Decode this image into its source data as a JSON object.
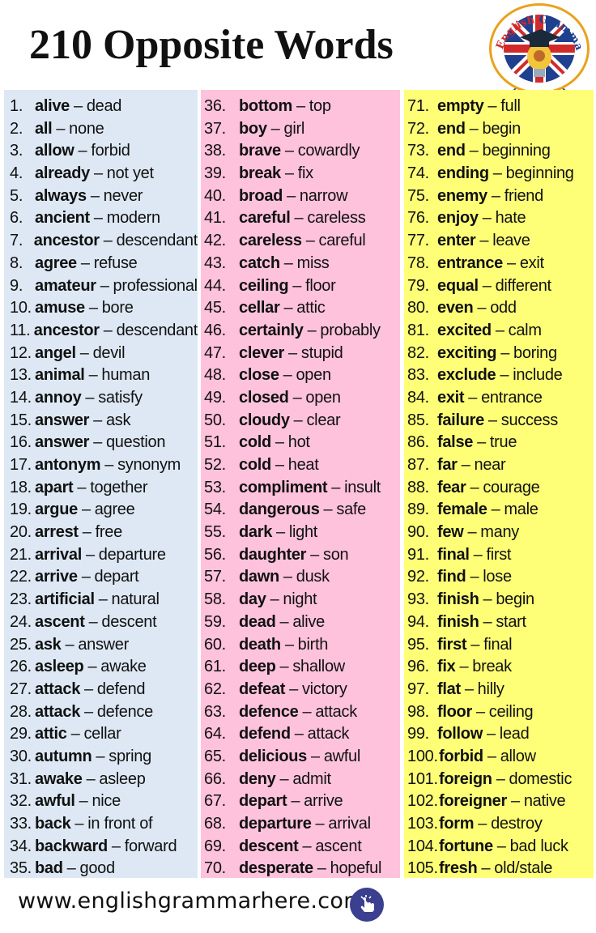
{
  "header": {
    "title": "210 Opposite Words",
    "logo": {
      "icon": "english-grammar-here-logo",
      "text_english": "English",
      "text_grammar": "Grammar",
      "text_here": "Here",
      "text_com": ".Com"
    }
  },
  "columns": [
    {
      "color": "#dde8f4",
      "items": [
        {
          "n": "1.",
          "word": "alive",
          "opposite": "dead"
        },
        {
          "n": "2.",
          "word": "all",
          "opposite": "none"
        },
        {
          "n": "3.",
          "word": "allow",
          "opposite": "forbid"
        },
        {
          "n": "4.",
          "word": "already",
          "opposite": "not yet"
        },
        {
          "n": "5.",
          "word": "always",
          "opposite": "never"
        },
        {
          "n": "6.",
          "word": "ancient",
          "opposite": "modern"
        },
        {
          "n": "7.",
          "word": "ancestor",
          "opposite": "descendant"
        },
        {
          "n": "8.",
          "word": "agree",
          "opposite": "refuse"
        },
        {
          "n": "9.",
          "word": "amateur",
          "opposite": "professional"
        },
        {
          "n": "10.",
          "word": "amuse",
          "opposite": "bore"
        },
        {
          "n": "11.",
          "word": "ancestor",
          "opposite": "descendant"
        },
        {
          "n": "12.",
          "word": "angel",
          "opposite": "devil"
        },
        {
          "n": "13.",
          "word": "animal",
          "opposite": "human"
        },
        {
          "n": "14.",
          "word": "annoy",
          "opposite": "satisfy"
        },
        {
          "n": "15.",
          "word": "answer",
          "opposite": "ask"
        },
        {
          "n": "16.",
          "word": "answer",
          "opposite": "question"
        },
        {
          "n": "17.",
          "word": "antonym",
          "opposite": "synonym"
        },
        {
          "n": "18.",
          "word": "apart",
          "opposite": "together"
        },
        {
          "n": "19.",
          "word": "argue",
          "opposite": "agree"
        },
        {
          "n": "20.",
          "word": "arrest",
          "opposite": "free"
        },
        {
          "n": "21.",
          "word": "arrival",
          "opposite": "departure"
        },
        {
          "n": "22.",
          "word": "arrive",
          "opposite": "depart"
        },
        {
          "n": "23.",
          "word": "artificial",
          "opposite": "natural"
        },
        {
          "n": "24.",
          "word": "ascent",
          "opposite": "descent"
        },
        {
          "n": "25.",
          "word": "ask",
          "opposite": "answer"
        },
        {
          "n": "26.",
          "word": "asleep",
          "opposite": "awake"
        },
        {
          "n": "27.",
          "word": "attack",
          "opposite": "defend"
        },
        {
          "n": "28.",
          "word": "attack",
          "opposite": "defence"
        },
        {
          "n": "29.",
          "word": "attic",
          "opposite": "cellar"
        },
        {
          "n": "30.",
          "word": "autumn",
          "opposite": "spring"
        },
        {
          "n": "31.",
          "word": "awake",
          "opposite": "asleep"
        },
        {
          "n": "32.",
          "word": "awful",
          "opposite": "nice"
        },
        {
          "n": "33.",
          "word": "back",
          "opposite": "in front of"
        },
        {
          "n": "34.",
          "word": "backward",
          "opposite": "forward"
        },
        {
          "n": "35.",
          "word": "bad",
          "opposite": "good"
        }
      ]
    },
    {
      "color": "#ffc2dc",
      "items": [
        {
          "n": "36.",
          "word": "bottom",
          "opposite": "top"
        },
        {
          "n": "37.",
          "word": "boy",
          "opposite": "girl"
        },
        {
          "n": "38.",
          "word": "brave",
          "opposite": "cowardly"
        },
        {
          "n": "39.",
          "word": "break",
          "opposite": "fix"
        },
        {
          "n": "40.",
          "word": "broad",
          "opposite": "narrow"
        },
        {
          "n": "41.",
          "word": "careful",
          "opposite": "careless"
        },
        {
          "n": "42.",
          "word": "careless",
          "opposite": "careful"
        },
        {
          "n": "43.",
          "word": "catch",
          "opposite": "miss"
        },
        {
          "n": "44.",
          "word": "ceiling",
          "opposite": "floor"
        },
        {
          "n": "45.",
          "word": "cellar",
          "opposite": "attic"
        },
        {
          "n": "46.",
          "word": "certainly",
          "opposite": "probably"
        },
        {
          "n": "47.",
          "word": "clever",
          "opposite": "stupid"
        },
        {
          "n": "48.",
          "word": "close",
          "opposite": "open"
        },
        {
          "n": "49.",
          "word": "closed",
          "opposite": "open"
        },
        {
          "n": "50.",
          "word": "cloudy",
          "opposite": "clear"
        },
        {
          "n": "51.",
          "word": "cold",
          "opposite": "hot"
        },
        {
          "n": "52.",
          "word": "cold",
          "opposite": "heat"
        },
        {
          "n": "53.",
          "word": "compliment",
          "opposite": "insult"
        },
        {
          "n": "54.",
          "word": "dangerous",
          "opposite": "safe"
        },
        {
          "n": "55.",
          "word": "dark",
          "opposite": "light"
        },
        {
          "n": "56.",
          "word": "daughter",
          "opposite": "son"
        },
        {
          "n": "57.",
          "word": "dawn",
          "opposite": "dusk"
        },
        {
          "n": "58.",
          "word": "day",
          "opposite": "night"
        },
        {
          "n": "59.",
          "word": "dead",
          "opposite": "alive"
        },
        {
          "n": "60.",
          "word": "death",
          "opposite": "birth"
        },
        {
          "n": "61.",
          "word": "deep",
          "opposite": "shallow"
        },
        {
          "n": "62.",
          "word": "defeat",
          "opposite": "victory"
        },
        {
          "n": "63.",
          "word": "defence",
          "opposite": "attack"
        },
        {
          "n": "64.",
          "word": "defend",
          "opposite": "attack"
        },
        {
          "n": "65.",
          "word": "delicious",
          "opposite": "awful"
        },
        {
          "n": "66.",
          "word": "deny",
          "opposite": "admit"
        },
        {
          "n": "67.",
          "word": "depart",
          "opposite": "arrive"
        },
        {
          "n": "68.",
          "word": "departure",
          "opposite": "arrival"
        },
        {
          "n": "69.",
          "word": "descent",
          "opposite": "ascent"
        },
        {
          "n": "70.",
          "word": "desperate",
          "opposite": "hopeful"
        }
      ]
    },
    {
      "color": "#ffff77",
      "items": [
        {
          "n": "71.",
          "word": "empty",
          "opposite": "full"
        },
        {
          "n": "72.",
          "word": "end",
          "opposite": "begin"
        },
        {
          "n": "73.",
          "word": "end",
          "opposite": "beginning"
        },
        {
          "n": "74.",
          "word": "ending",
          "opposite": "beginning"
        },
        {
          "n": "75.",
          "word": "enemy",
          "opposite": "friend"
        },
        {
          "n": "76.",
          "word": "enjoy",
          "opposite": "hate"
        },
        {
          "n": "77.",
          "word": "enter",
          "opposite": "leave"
        },
        {
          "n": "78.",
          "word": "entrance",
          "opposite": "exit"
        },
        {
          "n": "79.",
          "word": "equal",
          "opposite": "different"
        },
        {
          "n": "80.",
          "word": "even",
          "opposite": "odd"
        },
        {
          "n": "81.",
          "word": "excited",
          "opposite": "calm"
        },
        {
          "n": "82.",
          "word": "exciting",
          "opposite": "boring"
        },
        {
          "n": "83.",
          "word": "exclude",
          "opposite": "include"
        },
        {
          "n": "84.",
          "word": "exit",
          "opposite": "entrance"
        },
        {
          "n": "85.",
          "word": "failure",
          "opposite": "success"
        },
        {
          "n": "86.",
          "word": "false",
          "opposite": "true"
        },
        {
          "n": "87.",
          "word": "far",
          "opposite": "near"
        },
        {
          "n": "88.",
          "word": "fear",
          "opposite": "courage"
        },
        {
          "n": "89.",
          "word": "female",
          "opposite": "male"
        },
        {
          "n": "90.",
          "word": "few",
          "opposite": "many"
        },
        {
          "n": "91.",
          "word": "final",
          "opposite": "first"
        },
        {
          "n": "92.",
          "word": "find",
          "opposite": "lose"
        },
        {
          "n": "93.",
          "word": "finish",
          "opposite": "begin"
        },
        {
          "n": "94.",
          "word": "finish",
          "opposite": "start"
        },
        {
          "n": "95.",
          "word": "first",
          "opposite": "final"
        },
        {
          "n": "96.",
          "word": "fix",
          "opposite": "break"
        },
        {
          "n": "97.",
          "word": "flat",
          "opposite": "hilly"
        },
        {
          "n": "98.",
          "word": "floor",
          "opposite": "ceiling"
        },
        {
          "n": "99.",
          "word": "follow",
          "opposite": "lead"
        },
        {
          "n": "100.",
          "word": "forbid",
          "opposite": "allow"
        },
        {
          "n": "101.",
          "word": "foreign",
          "opposite": "domestic"
        },
        {
          "n": "102.",
          "word": "foreigner",
          "opposite": "native"
        },
        {
          "n": "103.",
          "word": "form",
          "opposite": "destroy"
        },
        {
          "n": "104.",
          "word": "fortune",
          "opposite": "bad luck"
        },
        {
          "n": "105.",
          "word": "fresh",
          "opposite": "old/stale"
        }
      ]
    }
  ],
  "separator": "–",
  "footer": {
    "url": "www.englishgrammarhere.com",
    "icon": "pointing-hand-icon",
    "icon_color": "#3b3f8f"
  }
}
